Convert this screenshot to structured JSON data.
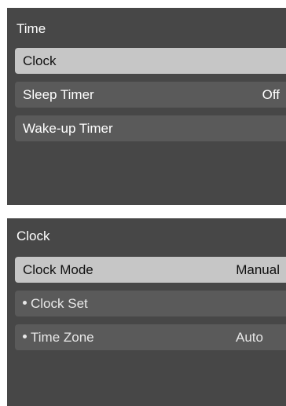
{
  "time_menu": {
    "title": "Time",
    "items": [
      {
        "label": "Clock",
        "value": ""
      },
      {
        "label": "Sleep Timer",
        "value": "Off"
      },
      {
        "label": "Wake-up Timer",
        "value": ""
      }
    ]
  },
  "clock_menu": {
    "title": "Clock",
    "items": [
      {
        "label": "Clock Mode",
        "value": "Manual"
      },
      {
        "label": "Clock Set",
        "value": ""
      },
      {
        "label": "Time Zone",
        "value": "Auto"
      }
    ]
  },
  "colors": {
    "panel_background": "#474747",
    "item_background": "#5a5a5a",
    "selected_item_background": "#c6c6c6",
    "text": "#ffffff",
    "selected_text": "#111111"
  }
}
